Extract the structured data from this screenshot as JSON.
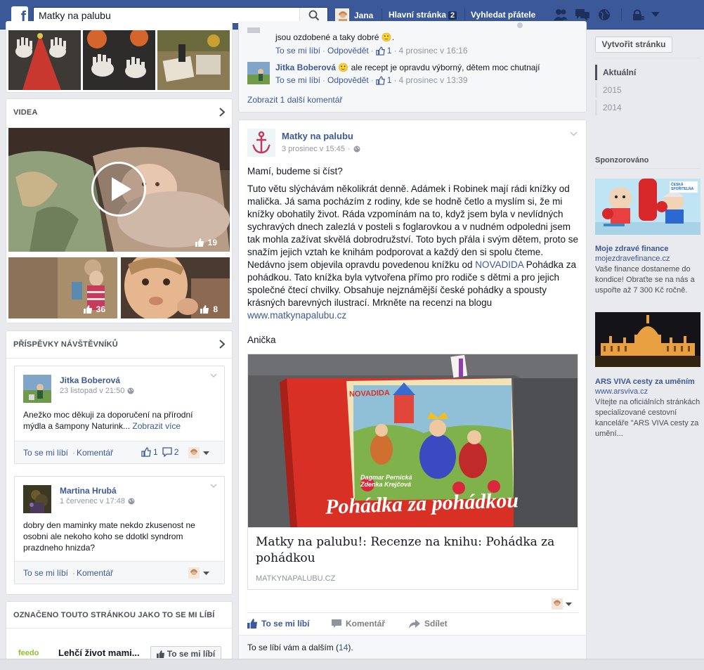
{
  "topbar": {
    "search_value": "Matky na palubu",
    "user_name": "Jana",
    "home_label": "Hlavní stránka",
    "home_badge": "2",
    "find_friends_label": "Vyhledat přátele",
    "accent": "#3b5998"
  },
  "left": {
    "videos": {
      "header": "VIDEA",
      "main_likes": "19",
      "small1_likes": "36",
      "small2_likes": "8"
    },
    "visitor_posts": {
      "header": "PŘÍSPĚVKY NÁVŠTĚVNÍKŮ",
      "posts": [
        {
          "author": "Jitka Boberová",
          "date": "23 listopad v 21:50",
          "text": "Anežko moc děkuji za doporučení na přírodní mýdla a šampony Naturink...",
          "see_more": "Zobrazit více",
          "like": "To se mi líbí",
          "comment": "Komentář",
          "like_count": "1",
          "comment_count": "2"
        },
        {
          "author": "Martina Hrubá",
          "date": "1 červenec v 17:48",
          "text": "dobry den maminky mate nekdo zkusenost ne osobni ale nekoho koho se ddotkl syndrom prazdneho hnizda?",
          "like": "To se mi líbí",
          "comment": "Komentář"
        }
      ]
    },
    "liked_pages": {
      "header": "OZNAČENO TOUTO STRÁNKOU JAKO TO SE MI LÍBÍ",
      "page_name": "Lehčí život mami...",
      "like_btn": "To se mi líbí",
      "logo_text": "feedo"
    }
  },
  "center": {
    "prev_post": {
      "comment1_tail": "jsou ozdobené a taky dobré 🙂.",
      "comment1_like": "To se mi líbí",
      "comment1_reply": "Odpovědět",
      "comment1_likes": "1",
      "comment1_date": "4 prosinec v 16:16",
      "comment2_author": "Jitka Boberová",
      "comment2_text": "🙂 ale recept je opravdu výborný, dětem moc chutnají",
      "comment2_like": "To se mi líbí",
      "comment2_reply": "Odpovědět",
      "comment2_likes": "1",
      "comment2_date": "4 prosinec v 13:39",
      "more_comments": "Zobrazit 1 další komentář"
    },
    "post": {
      "author": "Matky na palubu",
      "date": "3 prosinec v 15:45",
      "line1": "Mamí, budeme si číst?",
      "body_before": "Tuto větu slýchávám několikrát denně. Adámek i Robinek mají rádi knížky od malička. Já sama pocházím z rodiny, kde se hodně četlo a myslím si, že mi knížky obohatily život. Ráda vzpomínám na to, když jsem byla v nevlídných sychravých dnech zalezlá v posteli s foglarovkou a v nudném odpoledni jsem tak mohla zažívat skvělá dobrodružství. Toto bych přála i svým dětem, proto se snažím jejich vztah ke knihám podporovat a každý den si spolu čteme. Nedávno jsem objevila opravdu povedenou knížku od ",
      "body_link1": "NOVADIDA",
      "body_middle": " Pohádka za pohádkou. Tato knížka byla vytvořena přímo pro rodiče s dětmi a pro jejich společné čtecí chvilky. Obsahuje nejznámější české pohádky a spousty krásných barevných ilustrací. Mrkněte na recenzi na blogu ",
      "body_link2": "www.matkynapalubu.cz",
      "signature": "Anička",
      "book_brand": "NOVADIDA",
      "book_title": "Pohádka za pohádkou",
      "book_authors": "Dagmar Pernická",
      "book_authors2": "Zdenka Krejčová",
      "link_title": "Matky na palubu!: Recenze na knihu: Pohádka za pohádkou",
      "link_domain": "MATKYNAPALUBU.CZ",
      "action_like": "To se mi líbí",
      "action_comment": "Komentář",
      "action_share": "Sdílet",
      "likes_prefix": "To se líbí vám a dalším (",
      "likes_count": "14",
      "likes_suffix": ")."
    }
  },
  "right": {
    "create_page": "Vytvořit stránku",
    "years": [
      "Aktuální",
      "2015",
      "2014"
    ],
    "sponsored": "Sponzorováno",
    "ads": [
      {
        "title": "Moje zdravé finance",
        "url": "mojezdravefinance.cz",
        "text": "Vaše finance dostaneme do kondice! Obraťte se na nás a uspořte až 7 300 Kč ročně.",
        "logo": "ČESKÁ SPOŘITELNA"
      },
      {
        "title": "ARS VIVA cesty za uměním",
        "url": "www.arsviva.cz",
        "text": "Vítejte na oficiálních stránkách specializované cestovní kanceláře \"ARS VIVA cesty za umění..."
      }
    ]
  }
}
